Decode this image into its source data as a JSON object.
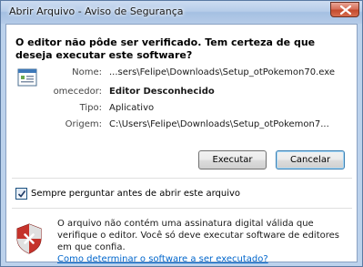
{
  "window": {
    "title": "Abrir Arquivo - Aviso de Segurança",
    "close_label": "X"
  },
  "dialog": {
    "heading": "O editor não pôde ser verificado. Tem certeza de que deseja executar este software?",
    "fields": {
      "name_label": "Nome:",
      "name_value": "...sers\\Felipe\\Downloads\\Setup_otPokemon70.exe",
      "publisher_label": "omecedor:",
      "publisher_value": "Editor Desconhecido",
      "type_label": "Tipo:",
      "type_value": "Aplicativo",
      "origin_label": "Origem:",
      "origin_value": "C:\\Users\\Felipe\\Downloads\\Setup_otPokemon7..."
    },
    "buttons": {
      "run": "Executar",
      "cancel": "Cancelar"
    },
    "checkbox": {
      "label": "Sempre perguntar antes de abrir este arquivo",
      "checked": true
    },
    "warning": {
      "text": "O arquivo não contém uma assinatura digital válida que verifique o editor. Você só deve executar software de editores em que confia.",
      "link": "Como determinar o software a ser executado?"
    }
  }
}
